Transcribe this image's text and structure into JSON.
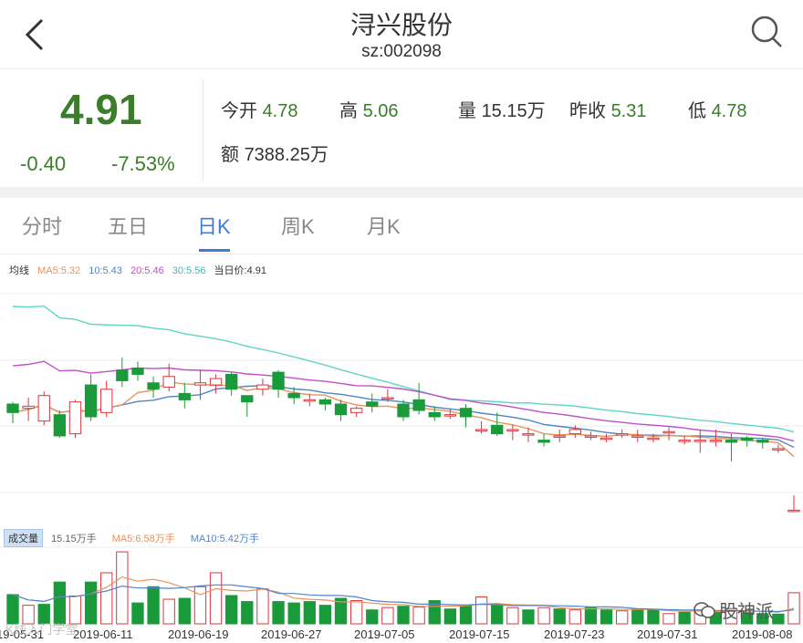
{
  "header": {
    "title": "浔兴股份",
    "code": "sz:002098",
    "back_icon": "chevron-left-icon",
    "search_icon": "search-icon"
  },
  "quote": {
    "price": "4.91",
    "change": "-0.40",
    "change_pct": "-7.53%",
    "open_label": "今开",
    "open": "4.78",
    "high_label": "高",
    "high": "5.06",
    "volume_label": "量",
    "volume": "15.15万",
    "prev_close_label": "昨收",
    "prev_close": "5.31",
    "low_label": "低",
    "low": "4.78",
    "amount_label": "额",
    "amount": "7388.25万",
    "down_color": "#3a7d2a"
  },
  "tabs": [
    {
      "label": "分时",
      "active": false
    },
    {
      "label": "五日",
      "active": false
    },
    {
      "label": "日K",
      "active": true
    },
    {
      "label": "周K",
      "active": false
    },
    {
      "label": "月K",
      "active": false
    }
  ],
  "ma_legend": {
    "label": "均线",
    "ma5": "MA5:5.32",
    "ma10": "10:5.43",
    "ma20": "20:5.46",
    "ma30": "30:5.56",
    "current": "当日价:4.91",
    "colors": {
      "ma5": "#e8935a",
      "ma10": "#4f86c6",
      "ma20": "#c04fc8",
      "ma30": "#5fd6c4"
    }
  },
  "vol_legend": {
    "tag": "成交量",
    "volume": "15.15万手",
    "ma5": "MA5:6.58万手",
    "ma10": "MA10:5.42万手"
  },
  "dates": [
    "19-05-31",
    "2019-06-11",
    "2019-06-19",
    "2019-06-27",
    "2019-07-05",
    "2019-07-15",
    "2019-07-23",
    "2019-07-31",
    "2019-08-08"
  ],
  "watermark": {
    "left": "K线入门学堂",
    "right": "股神派"
  },
  "chart_data": {
    "type": "candlestick",
    "candles": [
      [
        5.78,
        5.74,
        5.79,
        5.69
      ],
      [
        5.76,
        5.77,
        5.81,
        5.7
      ],
      [
        5.7,
        5.82,
        5.84,
        5.68
      ],
      [
        5.73,
        5.63,
        5.75,
        5.62
      ],
      [
        5.64,
        5.79,
        5.8,
        5.62
      ],
      [
        5.87,
        5.72,
        5.92,
        5.7
      ],
      [
        5.74,
        5.85,
        5.89,
        5.72
      ],
      [
        5.94,
        5.89,
        6.0,
        5.86
      ],
      [
        5.95,
        5.92,
        5.98,
        5.89
      ],
      [
        5.88,
        5.85,
        5.91,
        5.81
      ],
      [
        5.86,
        5.91,
        5.97,
        5.84
      ],
      [
        5.83,
        5.8,
        5.88,
        5.76
      ],
      [
        5.87,
        5.88,
        5.94,
        5.8
      ],
      [
        5.87,
        5.9,
        5.92,
        5.83
      ],
      [
        5.92,
        5.85,
        5.93,
        5.82
      ],
      [
        5.82,
        5.79,
        5.82,
        5.72
      ],
      [
        5.85,
        5.87,
        5.9,
        5.82
      ],
      [
        5.93,
        5.85,
        5.94,
        5.81
      ],
      [
        5.83,
        5.81,
        5.86,
        5.78
      ],
      [
        5.8,
        5.8,
        5.83,
        5.77
      ],
      [
        5.8,
        5.78,
        5.81,
        5.75
      ],
      [
        5.78,
        5.73,
        5.8,
        5.7
      ],
      [
        5.74,
        5.76,
        5.77,
        5.72
      ],
      [
        5.79,
        5.77,
        5.83,
        5.74
      ],
      [
        5.81,
        5.81,
        5.85,
        5.79
      ],
      [
        5.78,
        5.72,
        5.8,
        5.7
      ],
      [
        5.8,
        5.75,
        5.88,
        5.73
      ],
      [
        5.74,
        5.72,
        5.77,
        5.7
      ],
      [
        5.73,
        5.73,
        5.76,
        5.71
      ],
      [
        5.76,
        5.72,
        5.78,
        5.67
      ],
      [
        5.66,
        5.66,
        5.7,
        5.64
      ],
      [
        5.68,
        5.64,
        5.74,
        5.63
      ],
      [
        5.66,
        5.66,
        5.68,
        5.61
      ],
      [
        5.64,
        5.64,
        5.67,
        5.6
      ],
      [
        5.61,
        5.6,
        5.64,
        5.58
      ],
      [
        5.63,
        5.63,
        5.66,
        5.6
      ],
      [
        5.64,
        5.66,
        5.68,
        5.62
      ],
      [
        5.63,
        5.63,
        5.65,
        5.61
      ],
      [
        5.62,
        5.62,
        5.64,
        5.6
      ],
      [
        5.64,
        5.64,
        5.66,
        5.62
      ],
      [
        5.63,
        5.63,
        5.66,
        5.6
      ],
      [
        5.62,
        5.62,
        5.64,
        5.6
      ],
      [
        5.65,
        5.65,
        5.67,
        5.61
      ],
      [
        5.61,
        5.61,
        5.63,
        5.59
      ],
      [
        5.61,
        5.61,
        5.66,
        5.55
      ],
      [
        5.61,
        5.61,
        5.66,
        5.58
      ],
      [
        5.61,
        5.6,
        5.64,
        5.51
      ],
      [
        5.62,
        5.61,
        5.63,
        5.58
      ],
      [
        5.61,
        5.6,
        5.62,
        5.57
      ],
      [
        5.57,
        5.57,
        5.59,
        5.55
      ],
      [
        5.28,
        5.28,
        5.35,
        5.27
      ]
    ],
    "volumes": [
      6.3,
      4.0,
      4.2,
      9.0,
      6.0,
      9.0,
      11.0,
      15.5,
      4.5,
      8.0,
      5.3,
      5.5,
      8.0,
      11.0,
      6.1,
      4.8,
      7.5,
      4.8,
      4.5,
      4.8,
      4.0,
      5.5,
      5.0,
      3.0,
      3.5,
      3.8,
      3.6,
      5.0,
      3.2,
      3.8,
      5.8,
      4.2,
      3.5,
      3.0,
      3.5,
      3.2,
      3.0,
      3.5,
      3.0,
      2.8,
      3.2,
      3.0,
      2.2,
      2.5,
      3.0,
      2.6,
      3.3,
      2.4,
      2.2,
      2.1,
      6.7
    ],
    "volume_up": [
      false,
      true,
      false,
      false,
      true,
      false,
      true,
      true,
      false,
      false,
      true,
      false,
      true,
      true,
      false,
      false,
      true,
      false,
      false,
      false,
      false,
      false,
      true,
      false,
      true,
      false,
      true,
      false,
      false,
      false,
      true,
      false,
      true,
      false,
      true,
      false,
      true,
      false,
      false,
      true,
      false,
      false,
      true,
      false,
      true,
      false,
      true,
      false,
      false,
      false,
      true
    ],
    "ylim": [
      5.2,
      6.3
    ],
    "up_color": "#d9363e",
    "down_color": "#1a9a3a"
  }
}
